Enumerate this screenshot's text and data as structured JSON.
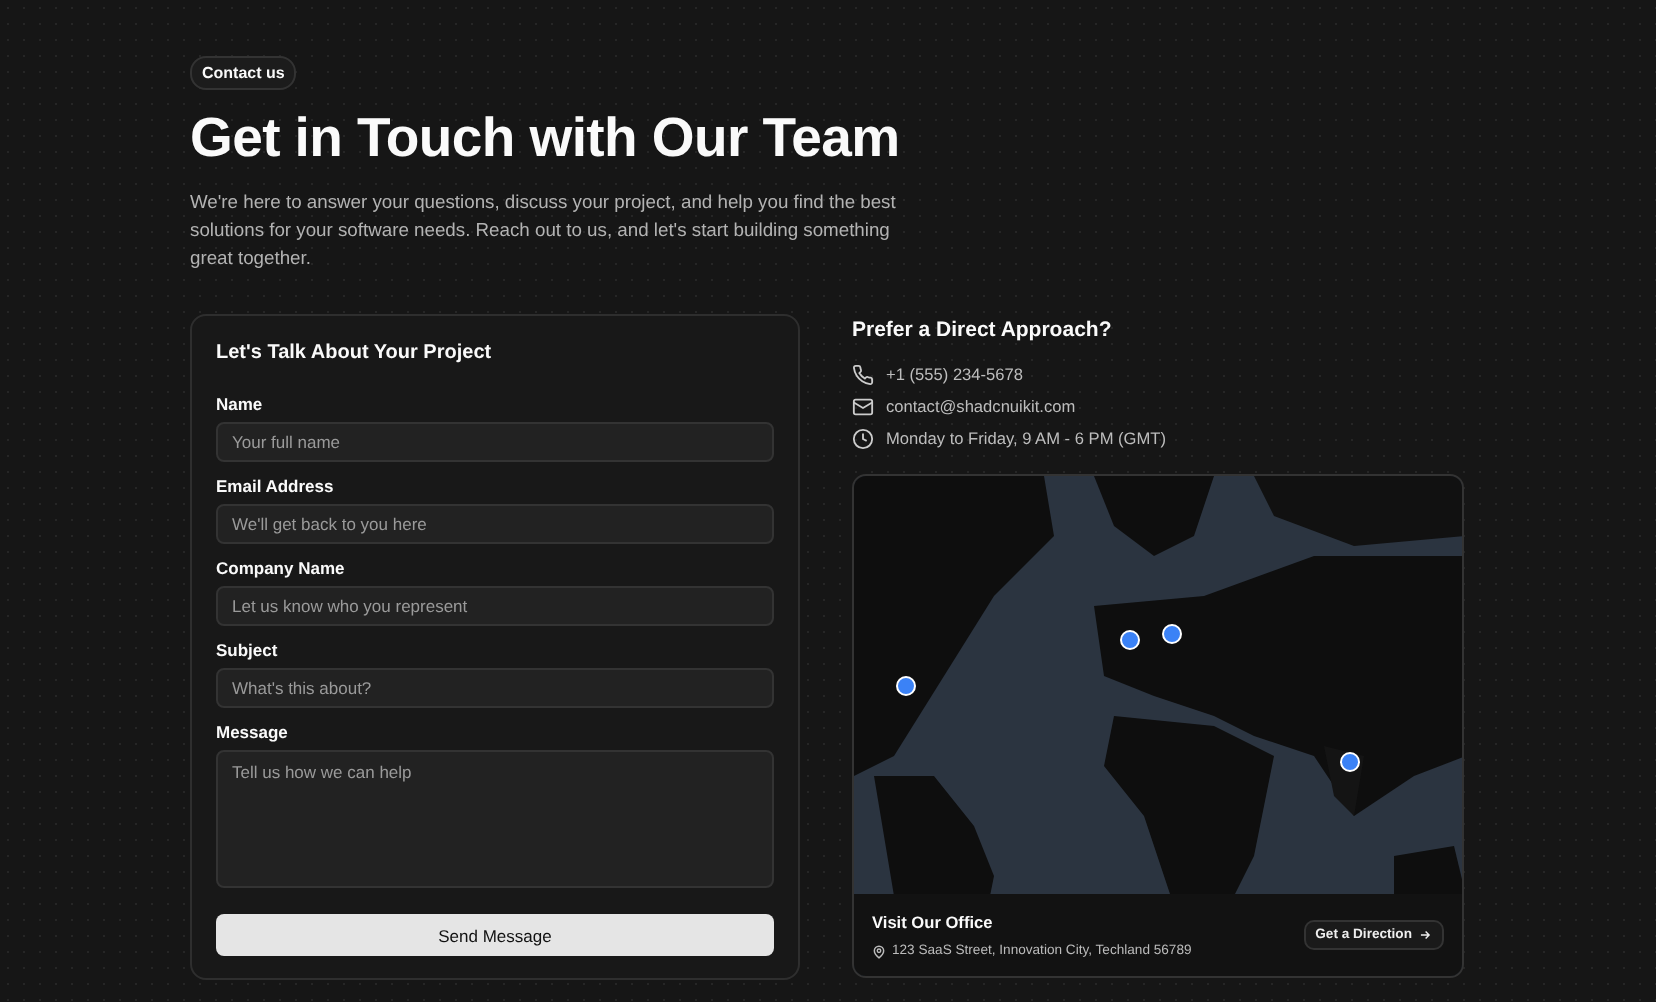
{
  "badge": "Contact us",
  "title": "Get in Touch with Our Team",
  "intro": "We're here to answer your questions, discuss your project, and help you find the best solutions for your software needs. Reach out to us, and let's start building something great together.",
  "form": {
    "title": "Let's Talk About Your Project",
    "fields": [
      {
        "kind": "input",
        "label": "Name",
        "placeholder": "Your full name"
      },
      {
        "kind": "input",
        "label": "Email Address",
        "placeholder": "We'll get back to you here"
      },
      {
        "kind": "input",
        "label": "Company Name",
        "placeholder": "Let us know who you represent"
      },
      {
        "kind": "input",
        "label": "Subject",
        "placeholder": "What's this about?"
      },
      {
        "kind": "textarea",
        "label": "Message",
        "placeholder": "Tell us how we can help"
      }
    ],
    "submit": "Send Message"
  },
  "direct": {
    "title": "Prefer a Direct Approach?",
    "items": [
      {
        "kind": "phone",
        "text": "+1 (555) 234-5678"
      },
      {
        "kind": "email",
        "text": "contact@shadcnuikit.com"
      },
      {
        "kind": "hours",
        "text": "Monday to Friday, 9 AM - 6 PM (GMT)"
      }
    ]
  },
  "office": {
    "title": "Visit Our Office",
    "address": "123 SaaS Street, Innovation City, Techland 56789",
    "button": "Get a Direction"
  }
}
